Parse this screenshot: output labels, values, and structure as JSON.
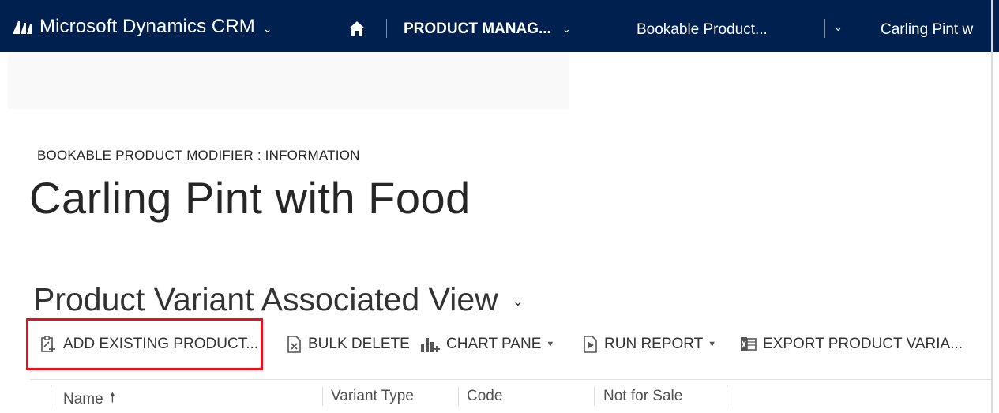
{
  "topbar": {
    "app_name": "Microsoft Dynamics CRM",
    "area": "PRODUCT MANAG...",
    "entity": "Bookable Product...",
    "record": "Carling Pint w"
  },
  "form": {
    "breadcrumb": "BOOKABLE PRODUCT MODIFIER : INFORMATION",
    "title": "Carling Pint with Food"
  },
  "view": {
    "title": "Product Variant Associated View"
  },
  "commands": {
    "add_existing": "ADD EXISTING PRODUCT...",
    "bulk_delete": "BULK DELETE",
    "chart_pane": "CHART PANE",
    "run_report": "RUN REPORT",
    "export": "EXPORT PRODUCT VARIA..."
  },
  "grid": {
    "columns": [
      "Name",
      "Variant Type",
      "Code",
      "Not for Sale"
    ]
  },
  "colors": {
    "topbar_bg": "#002050",
    "highlight": "#e8101c"
  }
}
